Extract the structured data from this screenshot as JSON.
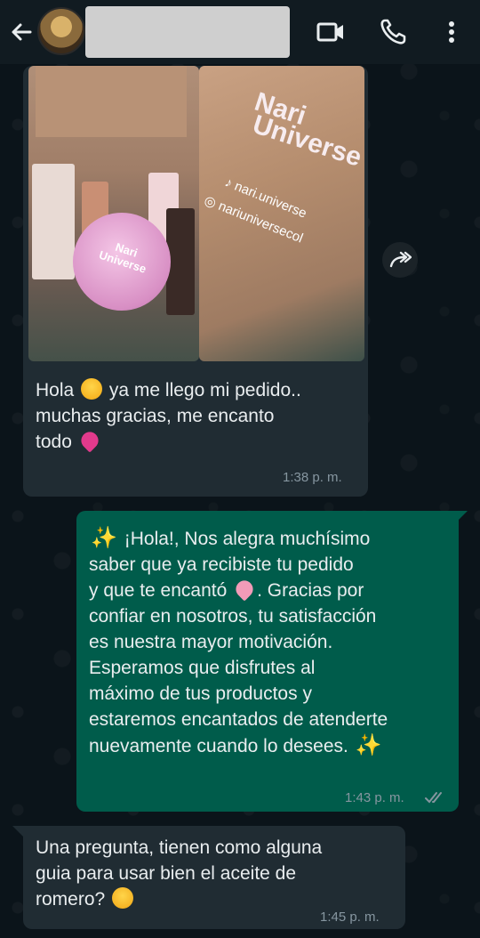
{
  "header": {
    "back_icon": "arrow-left-icon",
    "avatar_icon": "contact-avatar",
    "video_icon": "video-call-icon",
    "call_icon": "phone-icon",
    "menu_icon": "more-vertical-icon"
  },
  "messages": [
    {
      "direction": "incoming",
      "images": [
        {
          "caption_brand_top": "Nari",
          "caption_brand_bottom": "Universe",
          "alt": "product box with items"
        },
        {
          "brand_line1": "Nari",
          "brand_line2": "Universe",
          "handle1": "nari.universe",
          "handle2": "nariuniversecol",
          "alt": "shipping box"
        }
      ],
      "text_line1": "Hola",
      "text_line1_rest": "ya me llego mi pedido..",
      "text_line2": "muchas gracias, me encanto",
      "text_line3": "todo",
      "time": "1:38 p. m."
    },
    {
      "direction": "outgoing",
      "lines": [
        "¡Hola!,  Nos alegra muchísimo",
        "saber que ya recibiste tu pedido",
        "y que te encantó",
        ". Gracias por",
        "confiar en nosotros, tu satisfacción",
        "es nuestra mayor motivación.",
        "Esperamos que disfrutes al",
        "máximo de tus productos y",
        "estaremos encantados de atenderte",
        "nuevamente cuando lo desees."
      ],
      "time": "1:43 p. m.",
      "status": "read"
    },
    {
      "direction": "incoming",
      "line1": "Una pregunta, tienen como alguna",
      "line2": "guia para usar bien el aceite de",
      "line3": "romero?",
      "time": "1:45 p. m."
    }
  ],
  "colors": {
    "background": "#0b141a",
    "header": "#111b21",
    "incoming_bubble": "#202c33",
    "outgoing_bubble": "#005c4b",
    "text": "#e9edef",
    "meta": "#8696a0"
  }
}
